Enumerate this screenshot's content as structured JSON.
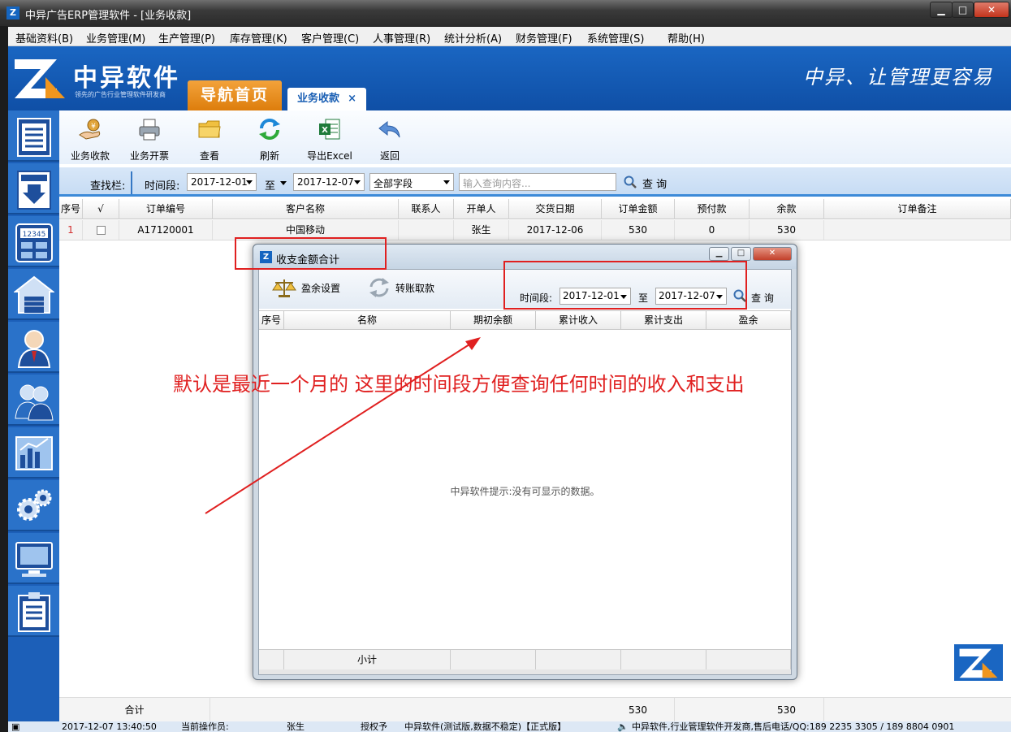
{
  "window": {
    "title": "中异广告ERP管理软件 - [业务收款]",
    "min": "▁",
    "max": "□",
    "close": "✕"
  },
  "menu": [
    "基础资料(B)",
    "业务管理(M)",
    "生产管理(P)",
    "库存管理(K)",
    "客户管理(C)",
    "人事管理(R)",
    "统计分析(A)",
    "财务管理(F)",
    "系统管理(S)",
    "帮助(H)"
  ],
  "banner": {
    "logo_text": "中异软件",
    "logo_sub": "领先的广告行业管理软件研发商",
    "home_tab": "导航首页",
    "active_tab": "业务收款",
    "active_tab_close": "×",
    "slogan": "中异、让管理更容易"
  },
  "toolbar": {
    "buttons": [
      "业务收款",
      "业务开票",
      "查看",
      "刷新",
      "导出Excel",
      "返回"
    ]
  },
  "search": {
    "label": "查找栏:",
    "period_label": "时间段:",
    "date_from": "2017-12-01",
    "to_label": "至",
    "date_to": "2017-12-07",
    "field": "全部字段",
    "placeholder": "输入查询内容...",
    "query": "查 询"
  },
  "grid": {
    "columns": [
      "序号",
      "√",
      "订单编号",
      "客户名称",
      "联系人",
      "开单人",
      "交货日期",
      "订单金额",
      "预付款",
      "余款",
      "订单备注"
    ],
    "rows": [
      {
        "seq": "1",
        "order_no": "A17120001",
        "customer": "中国移动",
        "contact": "",
        "creator": "张生",
        "delivery": "2017-12-06",
        "amount": "530",
        "prepay": "0",
        "balance": "530",
        "note": ""
      }
    ],
    "footer": {
      "label": "合计",
      "amount": "530",
      "balance": "530"
    }
  },
  "status": {
    "time": "2017-12-07 13:40:50",
    "operator_label": "当前操作员:",
    "operator": "张生",
    "authorized": "授权予",
    "edition": "中异软件(测试版,数据不稳定)【正式版】",
    "vendor": "中异软件,行业管理软件开发商,售后电话/QQ:189 2235 3305 / 189 8804 0901"
  },
  "dialog": {
    "title": "收支金额合计",
    "profit_setting": "盈余设置",
    "transfer": "转账取款",
    "period_label": "时间段:",
    "date_from": "2017-12-01",
    "to_label": "至",
    "date_to": "2017-12-07",
    "query": "查 询",
    "columns": [
      "序号",
      "名称",
      "期初余额",
      "累计收入",
      "累计支出",
      "盈余"
    ],
    "empty_tip": "中异软件提示:没有可显示的数据。",
    "subtotal": "小计"
  },
  "annotation": {
    "text": "默认是最近一个月的 这里的时间段方便查询任何时间的收入和支出",
    "color": "#e02020"
  },
  "colors": {
    "brand_blue": "#1a66c2",
    "accent_orange": "#f0961e"
  }
}
